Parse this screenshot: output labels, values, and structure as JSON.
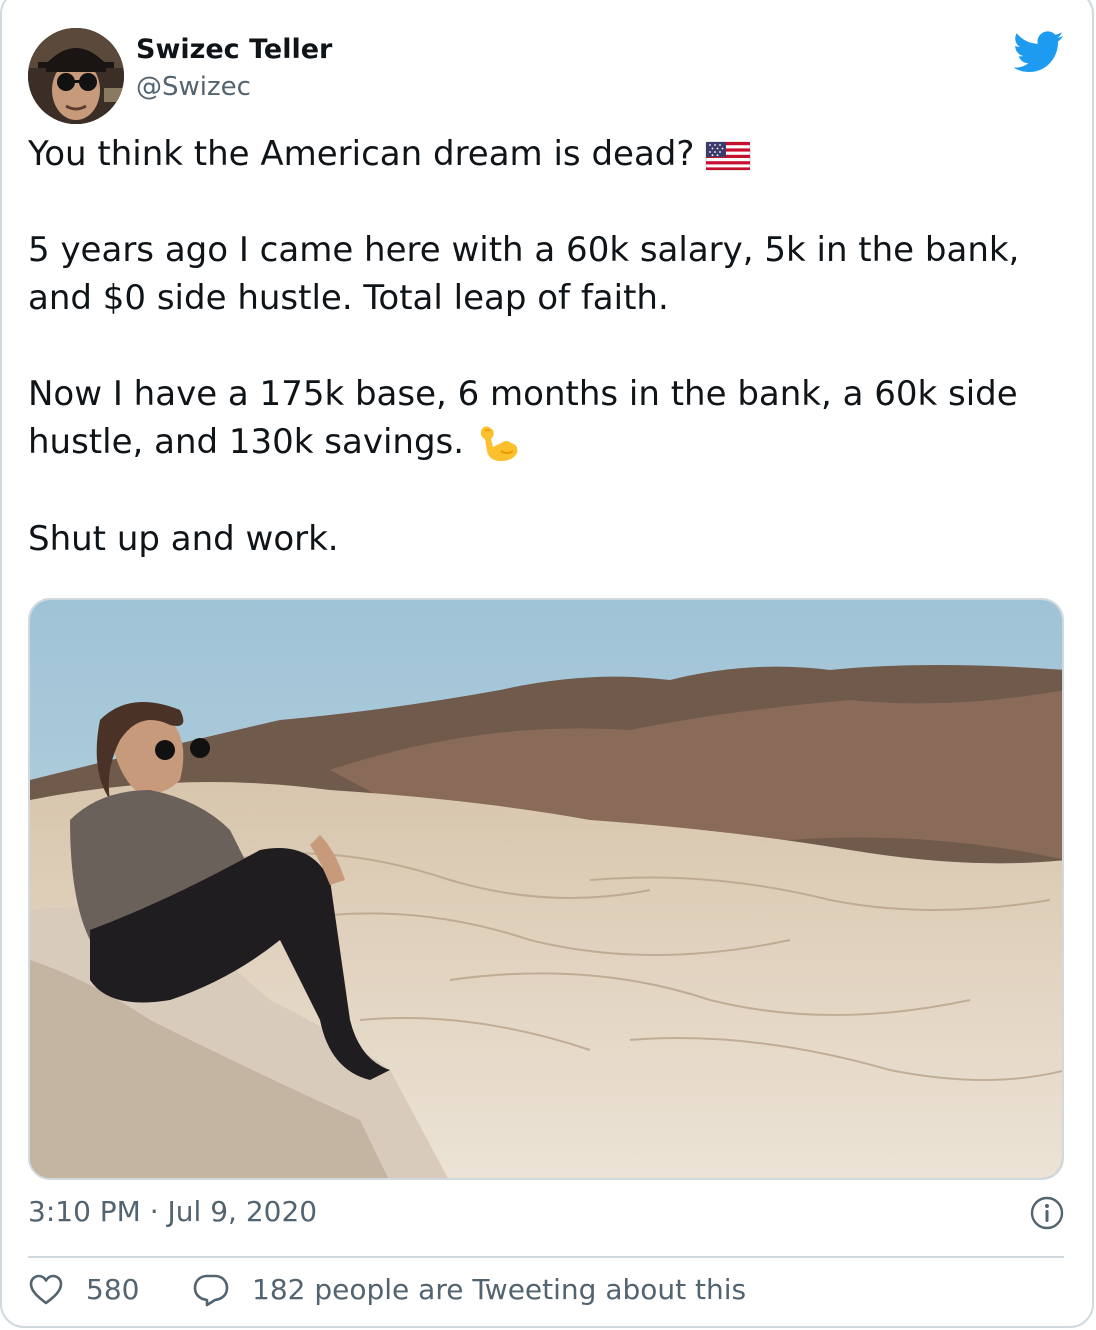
{
  "author": {
    "name": "Swizec Teller",
    "handle": "@Swizec"
  },
  "tweet": {
    "paragraphs": [
      "You think the American dream is dead?",
      "5 years ago I came here with a 60k salary, 5k in the bank, and $0 side hustle. Total leap of faith.",
      "Now I have a 175k base, 6 months in the bank, a 60k side hustle, and 130k savings.",
      "Shut up and work."
    ],
    "emoji_1": "us-flag-icon",
    "emoji_2": "flexed-biceps-icon"
  },
  "media": {
    "alt": "man in sunglasses sitting on a rock overlooking desert badlands"
  },
  "meta": {
    "timestamp": "3:10 PM · Jul 9, 2020"
  },
  "actions": {
    "likes": "580",
    "conversation": "182 people are Tweeting about this"
  },
  "colors": {
    "twitter_blue": "#1d9bf0",
    "secondary_text": "#536471",
    "border": "#cfd9de"
  }
}
